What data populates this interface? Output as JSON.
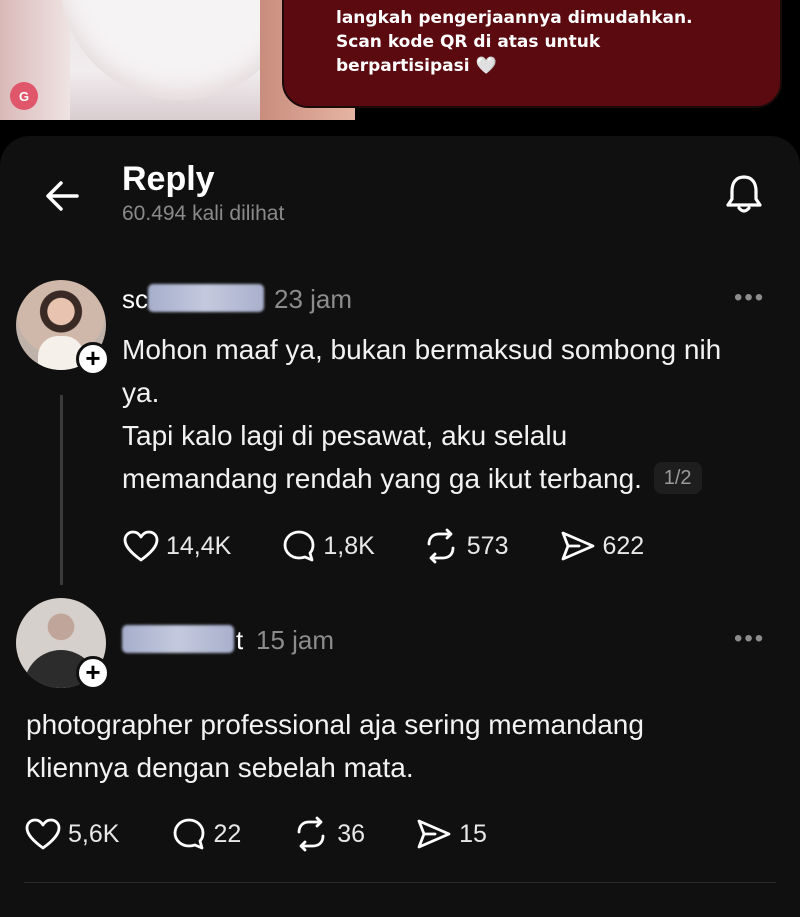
{
  "banner": {
    "text": "langkah pengerjaannya dimudahkan.\nScan kode QR di atas untuk\nberpartisipasi 🤍"
  },
  "header": {
    "title": "Reply",
    "views": "60.494 kali dilihat"
  },
  "post1": {
    "username_prefix": "sc",
    "username_suffix": "",
    "time": "23 jam",
    "text_line1": "Mohon maaf ya, bukan bermaksud sombong nih",
    "text_line2": "ya.",
    "text_line3": "Tapi kalo lagi di pesawat, aku selalu",
    "text_line4": "memandang rendah yang ga ikut terbang.",
    "counter": "1/2",
    "likes": "14,4K",
    "comments": "1,8K",
    "reposts": "573",
    "shares": "622"
  },
  "post2": {
    "username_suffix": "t",
    "time": "15 jam",
    "text_line1": "photographer professional aja sering memandang",
    "text_line2": "kliennya dengan sebelah mata.",
    "likes": "5,6K",
    "comments": "22",
    "reposts": "36",
    "shares": "15"
  },
  "more_label": "•••",
  "icons": [
    "back-arrow-icon",
    "bell-icon",
    "heart-icon",
    "comment-icon",
    "repost-icon",
    "share-icon",
    "plus-icon"
  ],
  "colors": {
    "banner": "#5b0a10",
    "panel": "#101010",
    "muted": "#8c8c8c"
  }
}
